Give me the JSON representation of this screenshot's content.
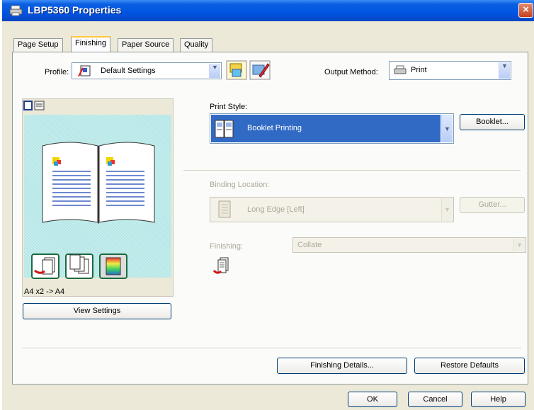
{
  "window": {
    "title": "LBP5360 Properties",
    "close_glyph": "×"
  },
  "tabs": [
    {
      "label": "Page Setup"
    },
    {
      "label": "Finishing"
    },
    {
      "label": "Paper Source"
    },
    {
      "label": "Quality"
    }
  ],
  "profile": {
    "label": "Profile:",
    "value": "Default Settings"
  },
  "output_method": {
    "label": "Output Method:",
    "value": "Print"
  },
  "preview": {
    "caption": "A4 x2 -> A4",
    "view_settings_label": "View Settings"
  },
  "print_style": {
    "label": "Print Style:",
    "value": "Booklet Printing",
    "booklet_button": "Booklet..."
  },
  "binding": {
    "label": "Binding Location:",
    "value": "Long Edge [Left]",
    "gutter_button": "Gutter..."
  },
  "finishing": {
    "label": "Finishing:",
    "value": "Collate"
  },
  "actions": {
    "finishing_details": "Finishing Details...",
    "restore_defaults": "Restore Defaults"
  },
  "dialog_buttons": {
    "ok": "OK",
    "cancel": "Cancel",
    "help": "Help"
  },
  "colors": {
    "titlebar": "#0054e3",
    "selection": "#316ac5",
    "preview_bg": "#b5e7e7",
    "panel_border": "#919b9c"
  }
}
